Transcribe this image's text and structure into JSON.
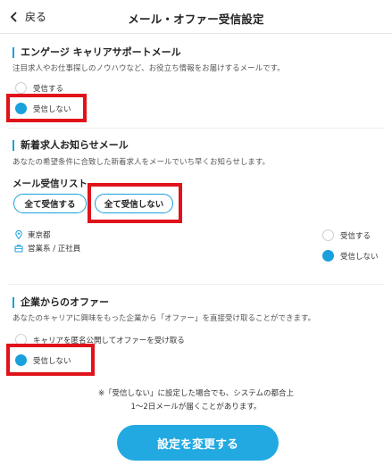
{
  "header": {
    "back_label": "戻る",
    "title": "メール・オファー受信設定"
  },
  "engage": {
    "title": "エンゲージ キャリアサポートメール",
    "desc": "注目求人やお仕事探しのノウハウなど、お役立ち情報をお届けするメールです。",
    "opt_receive": "受信する",
    "opt_decline": "受信しない"
  },
  "newjobs": {
    "title": "新着求人お知らせメール",
    "desc": "あなたの希望条件に合致した新着求人をメールでいち早くお知らせします。",
    "list_label": "メール受信リスト",
    "all_receive": "全て受信する",
    "all_decline": "全て受信しない",
    "location": "東京都",
    "jobtype": "営業系 / 正社員",
    "opt_receive": "受信する",
    "opt_decline": "受信しない"
  },
  "offers": {
    "title": "企業からのオファー",
    "desc": "あなたのキャリアに興味をもった企業から「オファー」を直接受け取ることができます。",
    "opt_receive": "キャリアを匿名公開してオファーを受け取る",
    "opt_decline": "受信しない"
  },
  "note": {
    "line1": "※「受信しない」に設定した場合でも、システムの都合上",
    "line2": "1〜2日メールが届くことがあります。"
  },
  "submit_label": "設定を変更する",
  "colors": {
    "accent": "#1aa0dc",
    "highlight": "#e0121a"
  }
}
